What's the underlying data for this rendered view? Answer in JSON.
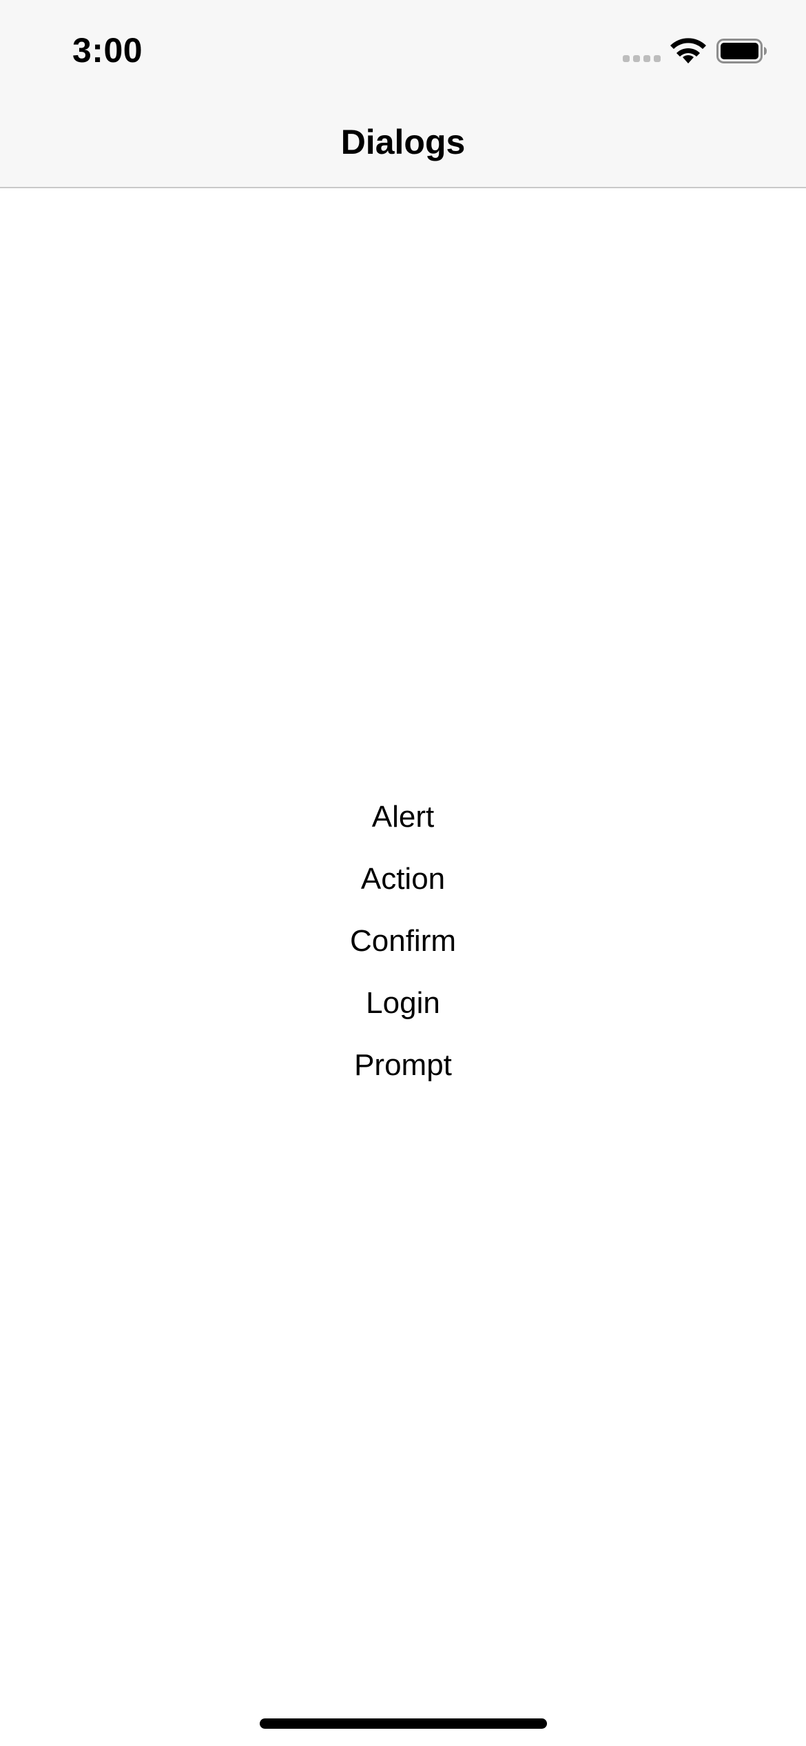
{
  "status_bar": {
    "time": "3:00",
    "icons": [
      "cellular-signal-icon",
      "wifi-icon",
      "battery-icon"
    ]
  },
  "nav_bar": {
    "title": "Dialogs"
  },
  "menu": {
    "items": [
      {
        "label": "Alert"
      },
      {
        "label": "Action"
      },
      {
        "label": "Confirm"
      },
      {
        "label": "Login"
      },
      {
        "label": "Prompt"
      }
    ]
  },
  "colors": {
    "nav_background": "#f7f7f7",
    "text": "#000000",
    "signal_inactive": "#bdbdbd"
  }
}
